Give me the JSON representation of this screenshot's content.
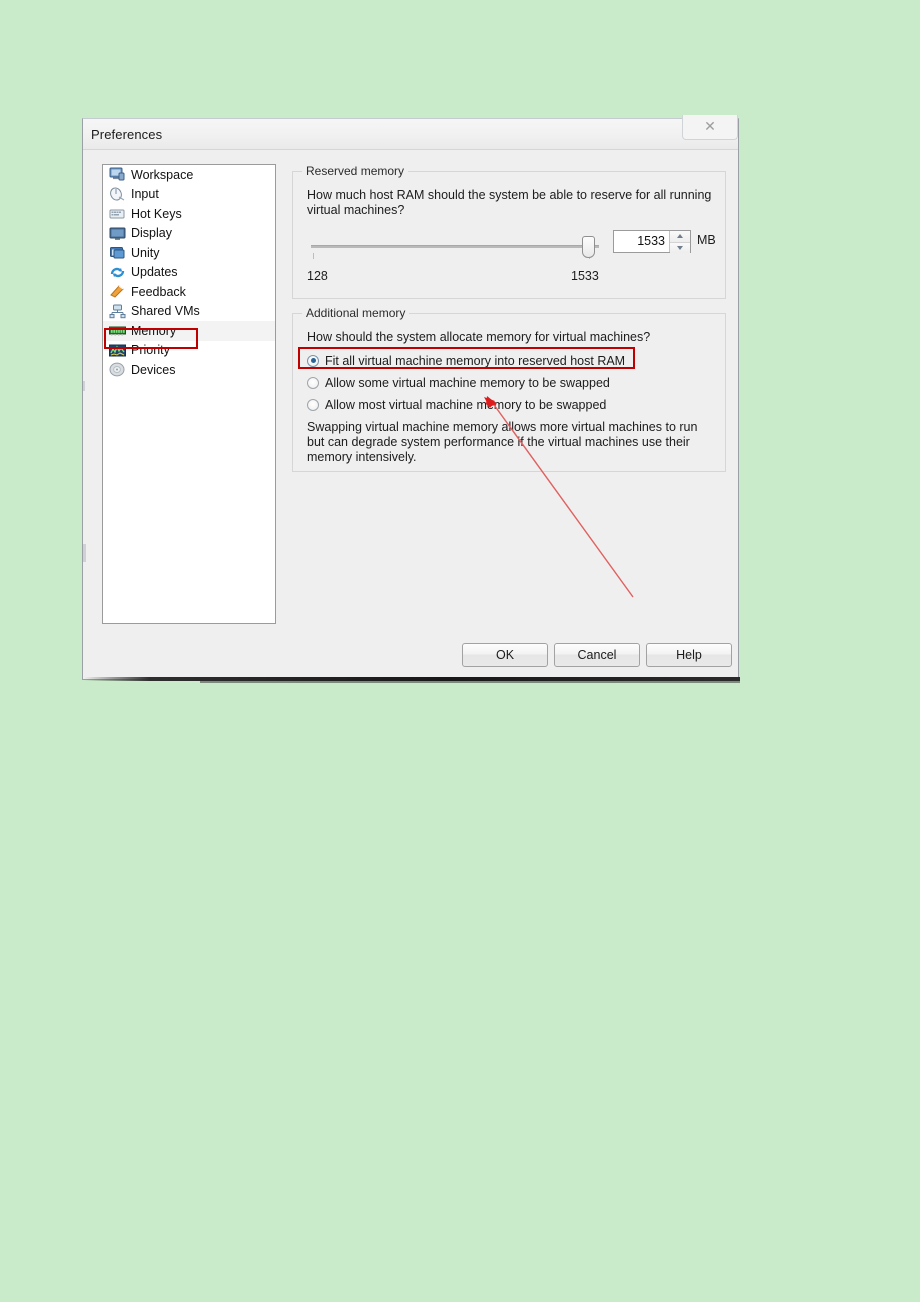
{
  "window": {
    "title": "Preferences",
    "close_icon": "close-icon",
    "close_glyph": "✕"
  },
  "sidebar": {
    "items": [
      {
        "label": "Workspace",
        "icon": "workspace-icon",
        "selected": false
      },
      {
        "label": "Input",
        "icon": "mouse-icon",
        "selected": false
      },
      {
        "label": "Hot Keys",
        "icon": "keyboard-icon",
        "selected": false
      },
      {
        "label": "Display",
        "icon": "monitor-icon",
        "selected": false
      },
      {
        "label": "Unity",
        "icon": "unity-window-icon",
        "selected": false
      },
      {
        "label": "Updates",
        "icon": "refresh-icon",
        "selected": false
      },
      {
        "label": "Feedback",
        "icon": "megaphone-icon",
        "selected": false
      },
      {
        "label": "Shared VMs",
        "icon": "shared-vms-icon",
        "selected": false
      },
      {
        "label": "Memory",
        "icon": "memory-chip-icon",
        "selected": true
      },
      {
        "label": "Priority",
        "icon": "priority-graph-icon",
        "selected": false
      },
      {
        "label": "Devices",
        "icon": "devices-disc-icon",
        "selected": false
      }
    ]
  },
  "reserved_memory": {
    "group_title": "Reserved memory",
    "description": "How much host RAM should the system be able to reserve for all running virtual machines?",
    "slider": {
      "min": "128",
      "max": "1533",
      "value": 1533,
      "percent": 100
    },
    "spinbox_value": "1533",
    "unit": "MB",
    "min_label": "128",
    "max_label": "1533"
  },
  "additional_memory": {
    "group_title": "Additional memory",
    "description": "How should the system allocate memory for virtual machines?",
    "options": [
      {
        "label": "Fit all virtual machine memory into reserved host RAM",
        "checked": true
      },
      {
        "label": "Allow some virtual machine memory to be swapped",
        "checked": false
      },
      {
        "label": "Allow most virtual machine memory to be swapped",
        "checked": false
      }
    ],
    "note": "Swapping virtual machine memory allows more virtual machines to run but can degrade system performance if the virtual machines use their memory intensively."
  },
  "buttons": {
    "ok": "OK",
    "cancel": "Cancel",
    "help": "Help"
  },
  "annotations": {
    "highlight_color": "#c00000",
    "arrow_color": "#e03030",
    "highlight_memory_item": "Memory",
    "highlight_radio_option": "Fit all virtual machine memory into reserved host RAM"
  },
  "colors": {
    "page_background": "#c9ebc9",
    "dialog_background": "#efefef",
    "accent": "#2a6496"
  }
}
